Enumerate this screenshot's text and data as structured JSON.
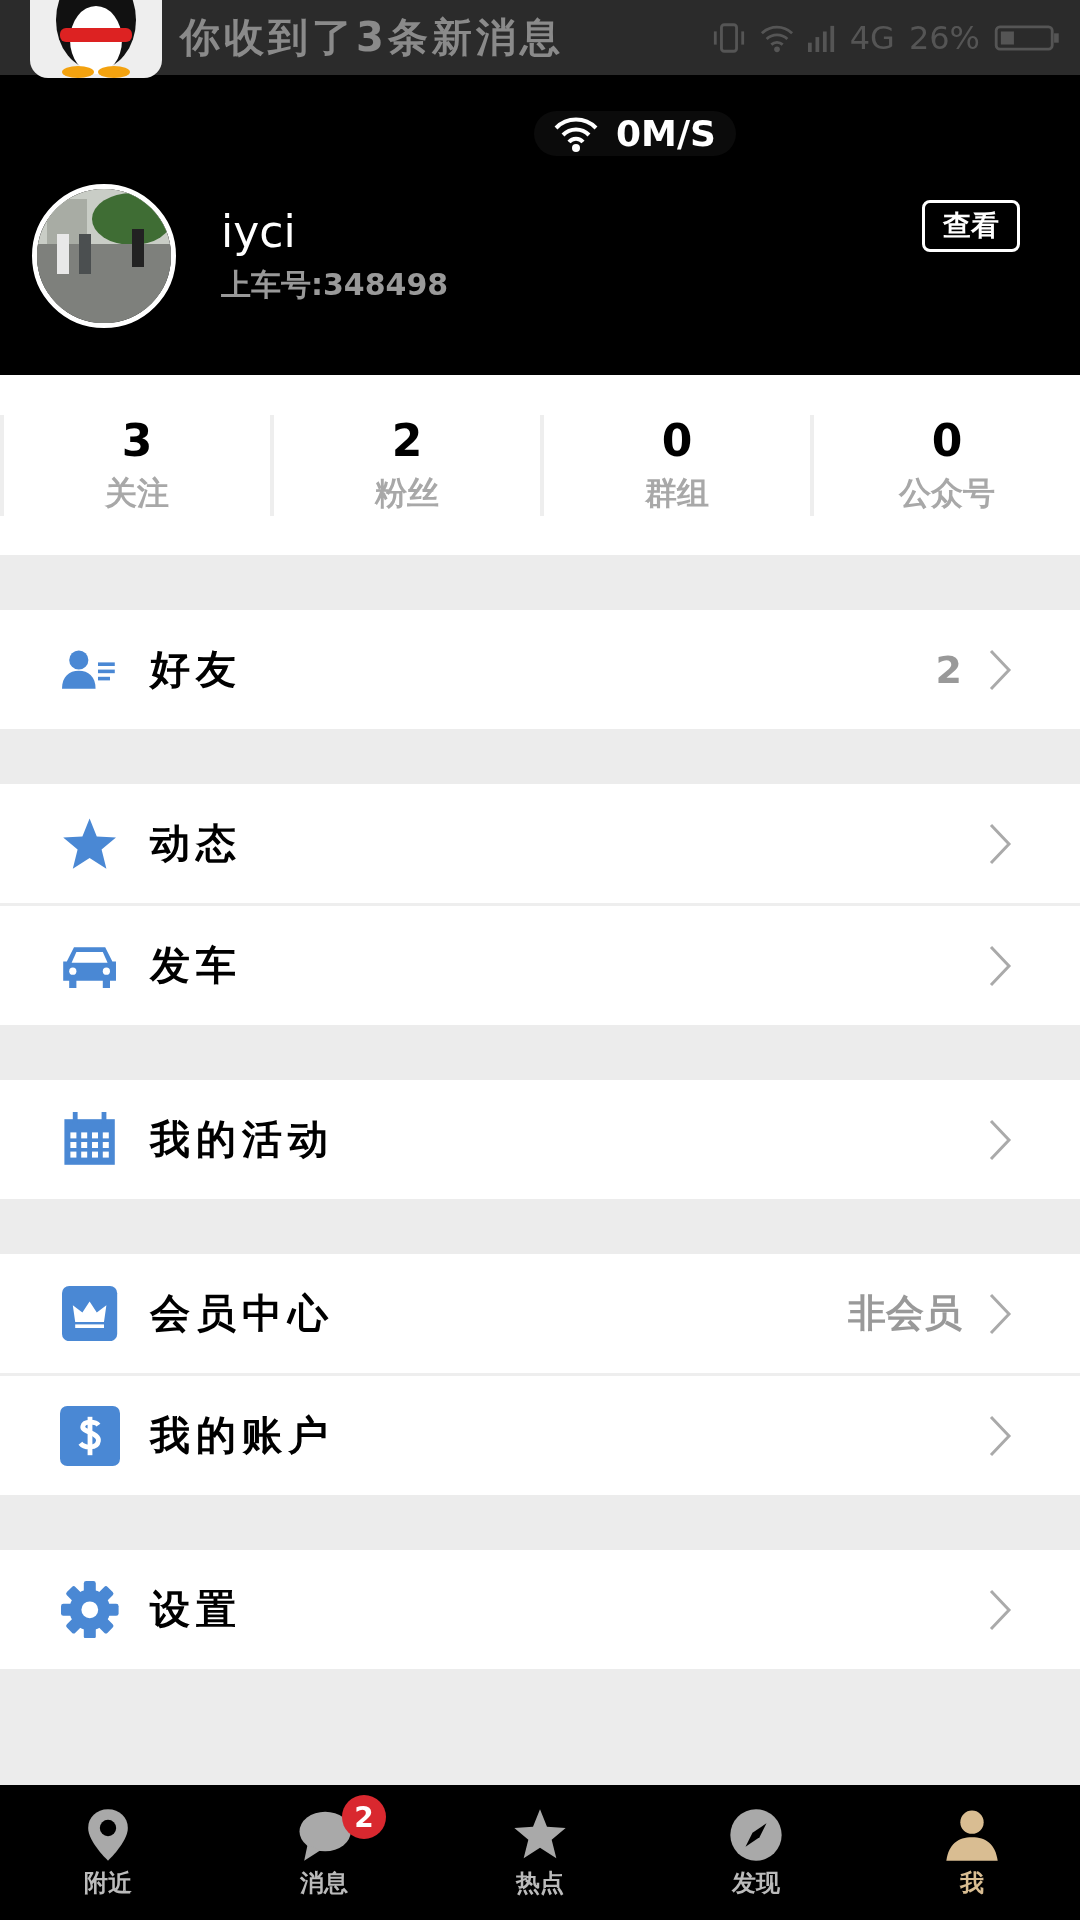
{
  "status_bar": {
    "notification": "你收到了3条新消息",
    "network": "4G",
    "battery": "26%"
  },
  "speed": "0M/S",
  "profile": {
    "name": "iyci",
    "account": "上车号:348498",
    "view_button": "查看"
  },
  "stats": [
    {
      "value": "3",
      "label": "关注"
    },
    {
      "value": "2",
      "label": "粉丝"
    },
    {
      "value": "0",
      "label": "群组"
    },
    {
      "value": "0",
      "label": "公众号"
    }
  ],
  "menu_groups": [
    [
      {
        "label": "好友",
        "value": "2"
      }
    ],
    [
      {
        "label": "动态"
      },
      {
        "label": "发车"
      }
    ],
    [
      {
        "label": "我的活动"
      }
    ],
    [
      {
        "label": "会员中心",
        "value": "非会员"
      },
      {
        "label": "我的账户"
      }
    ],
    [
      {
        "label": "设置"
      }
    ]
  ],
  "tab_bar": [
    {
      "label": "附近",
      "selected": false
    },
    {
      "label": "消息",
      "selected": false,
      "badge": "2"
    },
    {
      "label": "热点",
      "selected": false
    },
    {
      "label": "发现",
      "selected": false
    },
    {
      "label": "我",
      "selected": true
    }
  ]
}
